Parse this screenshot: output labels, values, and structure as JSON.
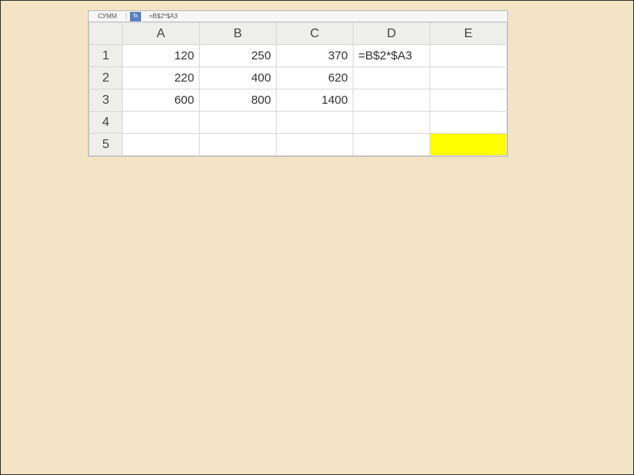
{
  "formula_bar": {
    "namebox": "СУММ",
    "fx_label": "fx",
    "formula": "=B$2*$A3"
  },
  "columns": [
    "A",
    "B",
    "C",
    "D",
    "E"
  ],
  "rows": [
    "1",
    "2",
    "3",
    "4",
    "5"
  ],
  "cells": {
    "A1": "120",
    "B1": "250",
    "C1": "370",
    "D1": "=B$2*$A3",
    "E1": "",
    "A2": "220",
    "B2": "400",
    "C2": "620",
    "D2": "",
    "E2": "",
    "A3": "600",
    "B3": "800",
    "C3": "1400",
    "D3": "",
    "E3": "",
    "A4": "",
    "B4": "",
    "C4": "",
    "D4": "",
    "E4": "",
    "A5": "",
    "B5": "",
    "C5": "",
    "D5": "",
    "E5": ""
  },
  "highlighted_cell": "E5"
}
